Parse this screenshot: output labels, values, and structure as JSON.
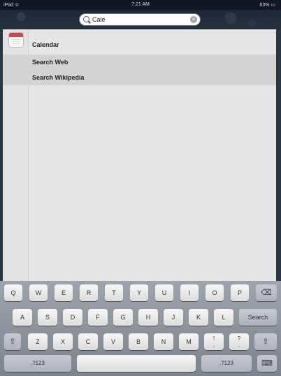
{
  "status_bar": {
    "carrier": "iPad ᯤ",
    "time": "7:21 AM",
    "battery": "63% ▭"
  },
  "search": {
    "value": "Cale",
    "clear_glyph": "×"
  },
  "results": [
    {
      "label": "Calendar",
      "icon": "calendar-icon"
    },
    {
      "label": "Search Web",
      "icon": "safari-icon"
    },
    {
      "label": "Search Wikipedia"
    }
  ],
  "keyboard": {
    "row1": [
      "Q",
      "W",
      "E",
      "R",
      "T",
      "Y",
      "U",
      "I",
      "O",
      "P"
    ],
    "row2": [
      "A",
      "S",
      "D",
      "F",
      "G",
      "H",
      "J",
      "K",
      "L"
    ],
    "row3": [
      "Z",
      "X",
      "C",
      "V",
      "B",
      "N",
      "M"
    ],
    "search_label": "Search",
    "numbers_label": ".?123",
    "backspace_glyph": "⌫",
    "shift_glyph": "⇧",
    "punct1_top": "!",
    "punct1_bottom": ",",
    "punct2_top": "?",
    "punct2_bottom": ".",
    "hide_glyph": "⌨"
  },
  "colors": {
    "highlight": "#d3d3d3",
    "pane": "#e6e6e6"
  }
}
